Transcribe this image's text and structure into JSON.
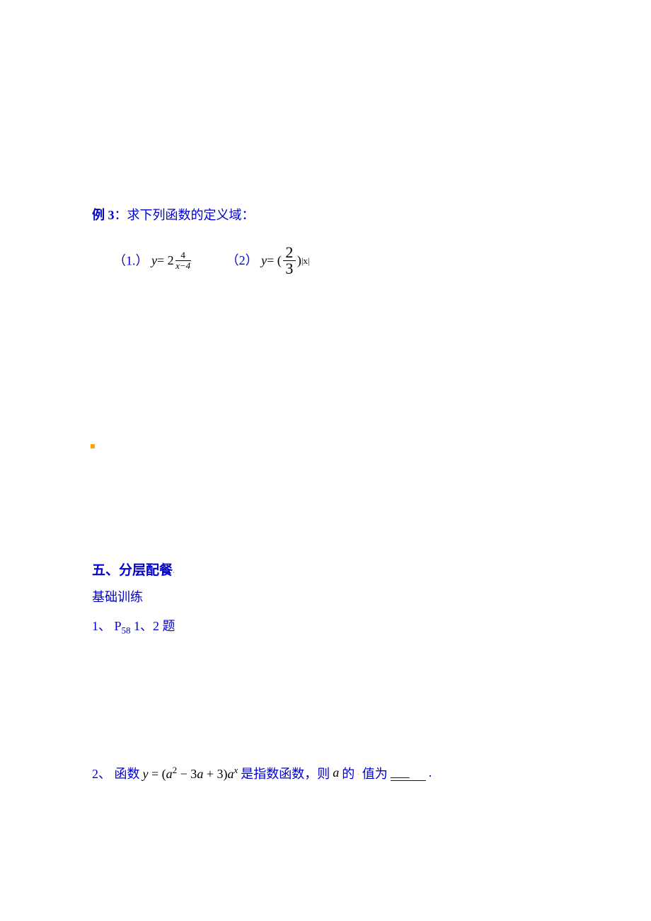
{
  "example": {
    "label_prefix": "例 3",
    "label_suffix": "：求下列函数的定义域：",
    "sub1_label": "（1.）",
    "sub1_formula_base": "y",
    "sub1_formula_eq": " = 2",
    "sub1_exp_num": "4",
    "sub1_exp_den": "x−4",
    "sub2_label": "（2）",
    "sub2_formula_base": "y",
    "sub2_formula_eq": " = (",
    "sub2_frac_num": "2",
    "sub2_frac_den": "3",
    "sub2_formula_close": ")",
    "sub2_exp": "|x|"
  },
  "section5": {
    "title": "五、分层配餐",
    "subsection": "基础训练",
    "q1_prefix": "1、 P",
    "q1_sub": "58",
    "q1_suffix": " 1、2 题",
    "q2_prefix": "2、 函数 ",
    "q2_formula_y": "y",
    "q2_formula_eq": " = (",
    "q2_formula_a": "a",
    "q2_formula_sup2": "2",
    "q2_formula_minus": " − 3",
    "q2_formula_a2": "a",
    "q2_formula_plus": " + 3)",
    "q2_formula_a3": "a",
    "q2_formula_supx": "x",
    "q2_middle": " 是指数函数，则 ",
    "q2_formula_a4": "a",
    "q2_suffix": " 的",
    "q2_suffix2": "值为",
    "q2_period": "."
  }
}
